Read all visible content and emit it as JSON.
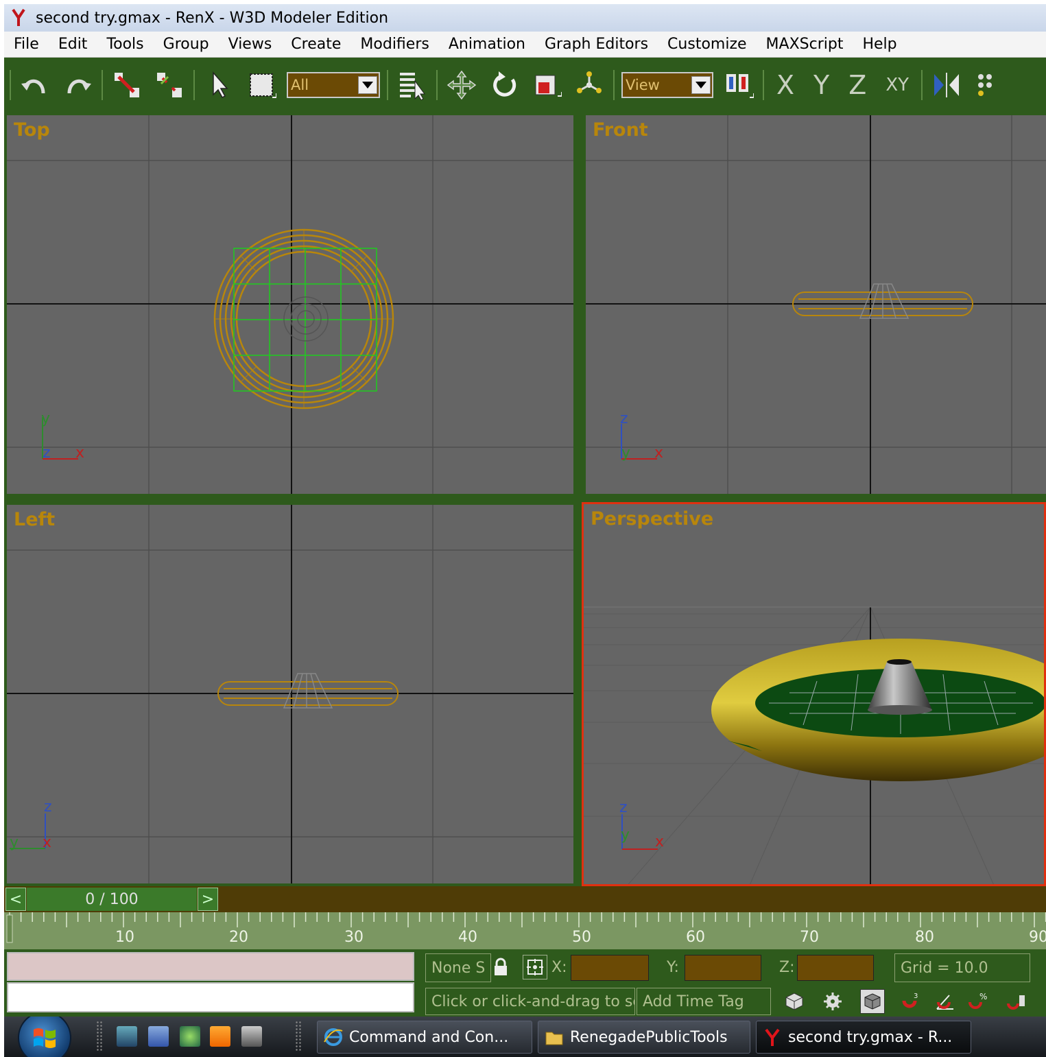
{
  "window": {
    "title": "second try.gmax - RenX - W3D Modeler Edition"
  },
  "menu": [
    "File",
    "Edit",
    "Tools",
    "Group",
    "Views",
    "Create",
    "Modifiers",
    "Animation",
    "Graph Editors",
    "Customize",
    "MAXScript",
    "Help"
  ],
  "toolbar": {
    "selection_filter": "All",
    "reference_coord": "View",
    "axis_x": "X",
    "axis_y": "Y",
    "axis_z": "Z",
    "axis_xy": "XY"
  },
  "viewports": {
    "top": {
      "label": "Top",
      "axis": {
        "vert": "y",
        "depth": "z",
        "horiz": "x"
      }
    },
    "front": {
      "label": "Front",
      "axis": {
        "vert": "z",
        "depth": "y",
        "horiz": "x"
      }
    },
    "left": {
      "label": "Left",
      "axis": {
        "vert": "z",
        "horiz": "y",
        "depth": "x"
      }
    },
    "perspective": {
      "label": "Perspective",
      "axis": {
        "vert": "z",
        "depth": "y",
        "horiz": "x"
      },
      "active": true
    }
  },
  "time": {
    "prev": "<",
    "frame_display": "0 / 100",
    "next": ">",
    "ticks": [
      "10",
      "20",
      "30",
      "40",
      "50",
      "60",
      "70",
      "80",
      "90"
    ]
  },
  "status": {
    "selection": "None S",
    "x_label": "X:",
    "y_label": "Y:",
    "z_label": "Z:",
    "grid": "Grid = 10.0",
    "prompt": "Click or click-and-drag to selec",
    "time_tag": "Add Time Tag"
  },
  "taskbar": {
    "tasks": [
      "Command and Con...",
      "RenegadePublicTools",
      "second try.gmax - R..."
    ]
  },
  "colors": {
    "toolbar_green": "#2e5a1c",
    "viewport_gray": "#656565",
    "label_gold": "#b8860b",
    "active_border": "#e03010",
    "torus_gold": "#b8860b"
  }
}
